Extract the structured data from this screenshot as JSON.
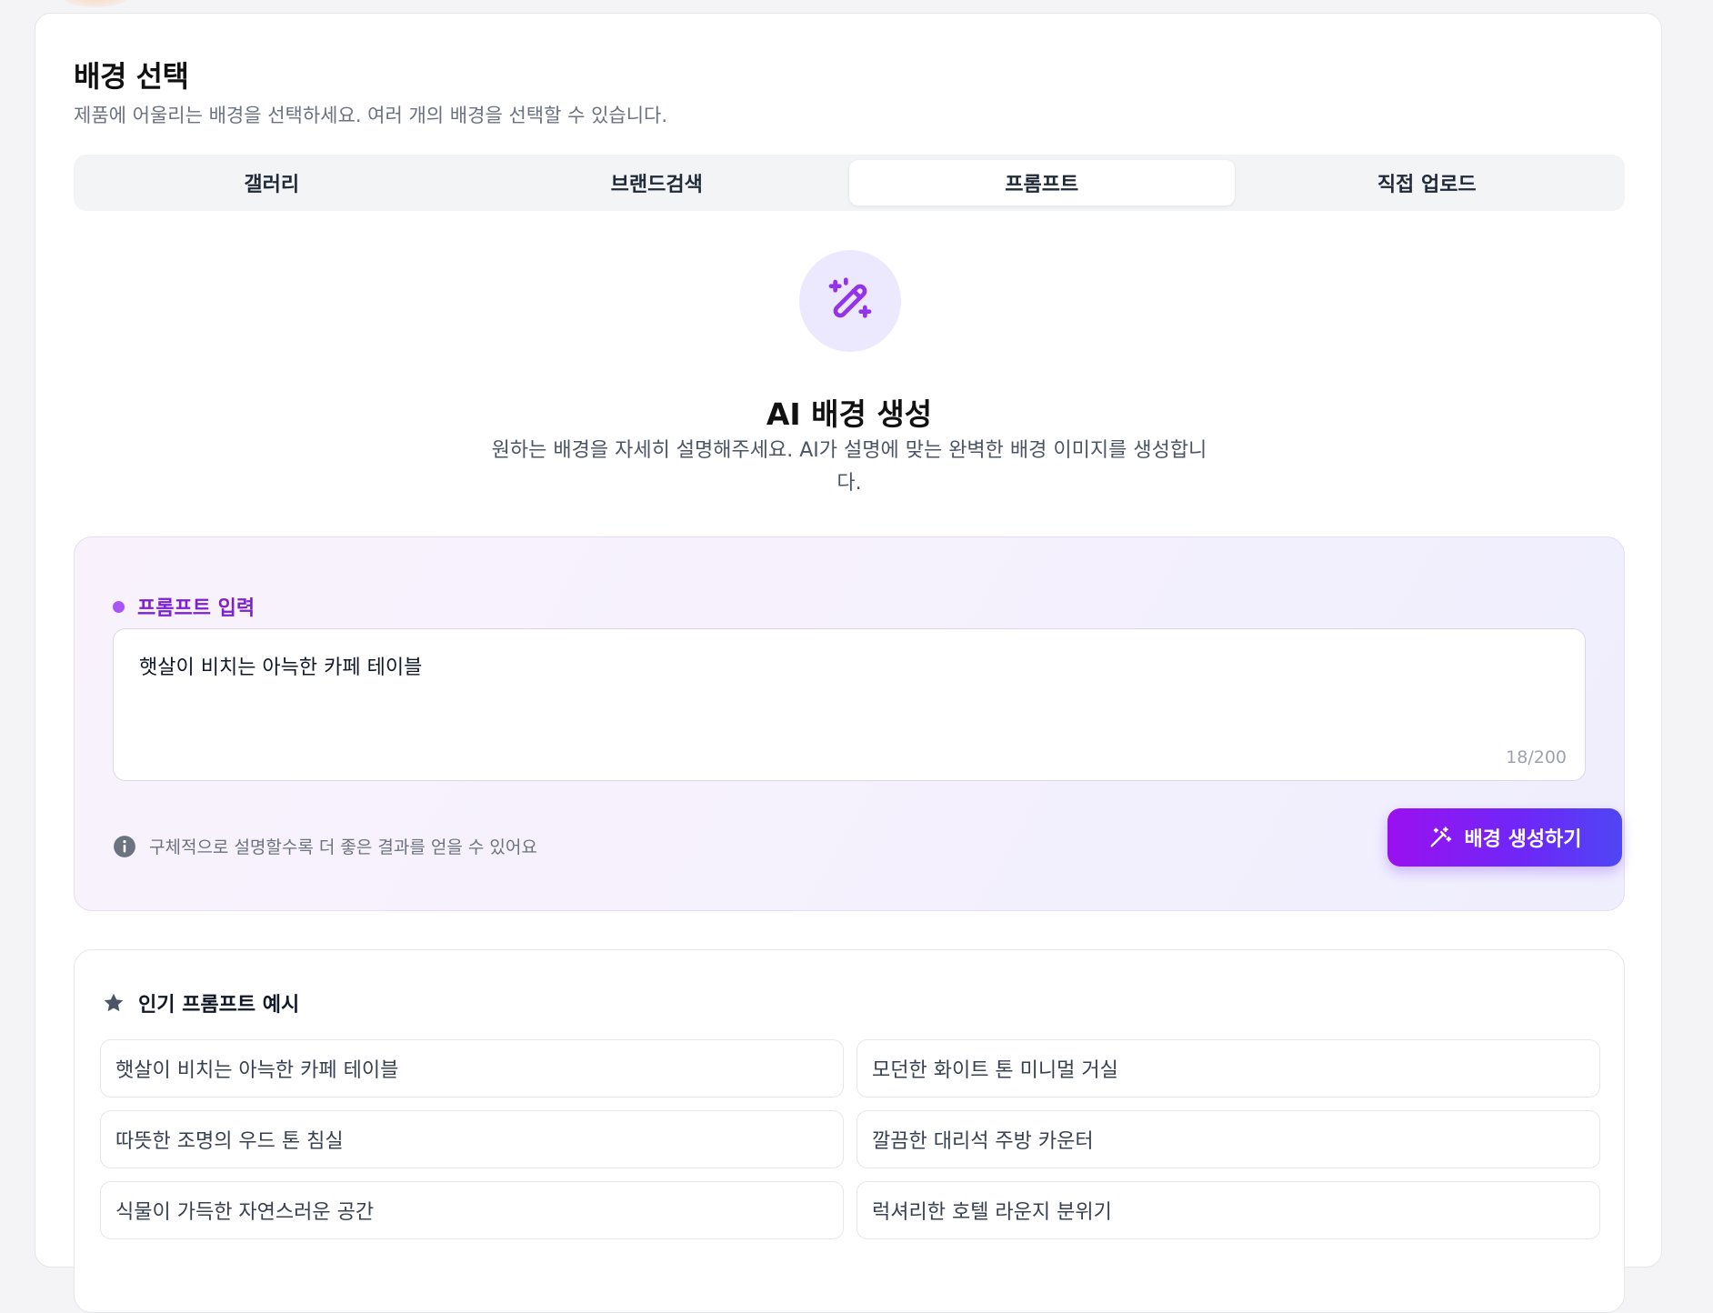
{
  "header": {
    "title": "배경 선택",
    "subtitle": "제품에 어울리는 배경을 선택하세요. 여러 개의 배경을 선택할 수 있습니다."
  },
  "tabs": [
    {
      "label": "갤러리",
      "active": false
    },
    {
      "label": "브랜드검색",
      "active": false
    },
    {
      "label": "프롬프트",
      "active": true
    },
    {
      "label": "직접 업로드",
      "active": false
    }
  ],
  "hero": {
    "icon": "magic-wand-icon",
    "title": "AI 배경 생성",
    "description": "원하는 배경을 자세히 설명해주세요. AI가 설명에 맞는 완벽한 배경 이미지를 생성합니다."
  },
  "prompt": {
    "label": "프롬프트 입력",
    "value": "햇살이 비치는 아늑한 카페 테이블",
    "char_count": "18/200",
    "hint": "구체적으로 설명할수록 더 좋은 결과를 얻을 수 있어요",
    "generate_label": "배경 생성하기"
  },
  "examples": {
    "title": "인기 프롬프트 예시",
    "items": [
      "햇살이 비치는 아늑한 카페 테이블",
      "모던한 화이트 톤 미니멀 거실",
      "따뜻한 조명의 우드 톤 침실",
      "깔끔한 대리석 주방 카운터",
      "식물이 가득한 자연스러운 공간",
      "럭셔리한 호텔 라운지 분위기"
    ]
  },
  "colors": {
    "accent": "#7c3aed",
    "accent_gradient_start": "#9b10f0",
    "accent_gradient_end": "#4f46f5",
    "label_purple": "#7e22ce"
  }
}
